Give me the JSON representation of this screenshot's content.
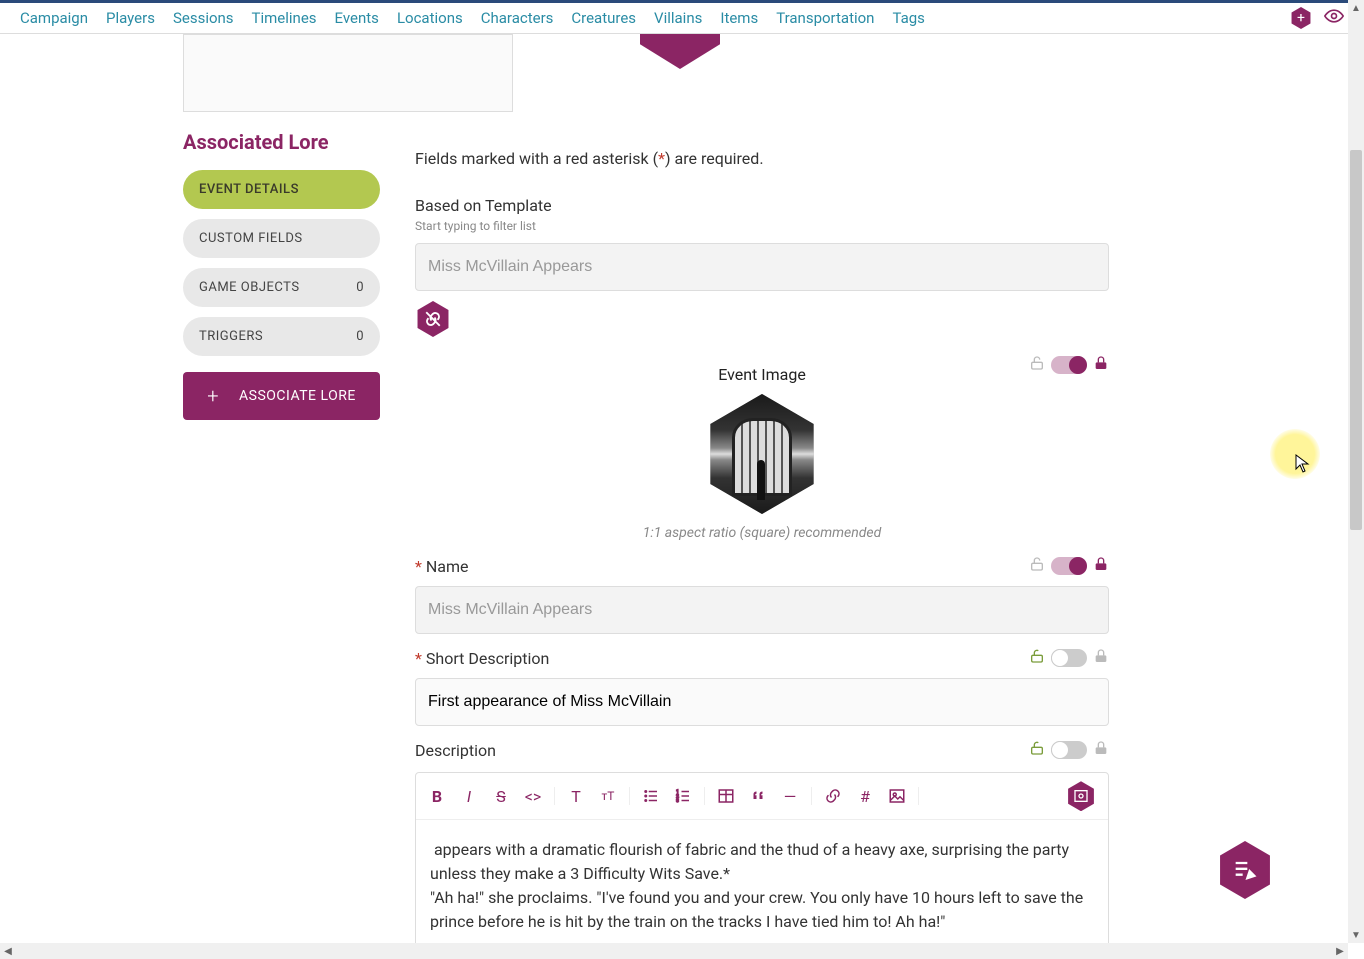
{
  "nav": [
    "Campaign",
    "Players",
    "Sessions",
    "Timelines",
    "Events",
    "Locations",
    "Characters",
    "Creatures",
    "Villains",
    "Items",
    "Transportation",
    "Tags"
  ],
  "sidebar": {
    "title": "Associated Lore",
    "tabs": [
      {
        "label": "Event Details",
        "active": true
      },
      {
        "label": "Custom Fields"
      },
      {
        "label": "Game Objects",
        "count": "0"
      },
      {
        "label": "Triggers",
        "count": "0"
      }
    ],
    "assoc_btn": "Associate Lore"
  },
  "form": {
    "required_hint_pre": "Fields marked with a red asterisk (",
    "required_ast": "*",
    "required_hint_post": ") are required.",
    "template_label": "Based on Template",
    "template_hint": "Start typing to filter list",
    "template_value": "Miss McVillain Appears",
    "event_image_label": "Event Image",
    "event_image_caption": "1:1 aspect ratio (square) recommended",
    "name_label": "Name",
    "name_value": "Miss McVillain Appears",
    "short_desc_label": "Short Description",
    "short_desc_value": "First appearance of Miss McVillain",
    "desc_label": "Description",
    "desc_body": " appears with a dramatic flourish of fabric and the thud of a heavy axe, surprising the party unless they make a 3 Difficulty Wits Save.*\n\"Ah ha!\" she proclaims. \"I've found you and your crew. You only have 10 hours left to save the prince before he is hit by the train on the tracks I have tied him to! Ah ha!\""
  }
}
